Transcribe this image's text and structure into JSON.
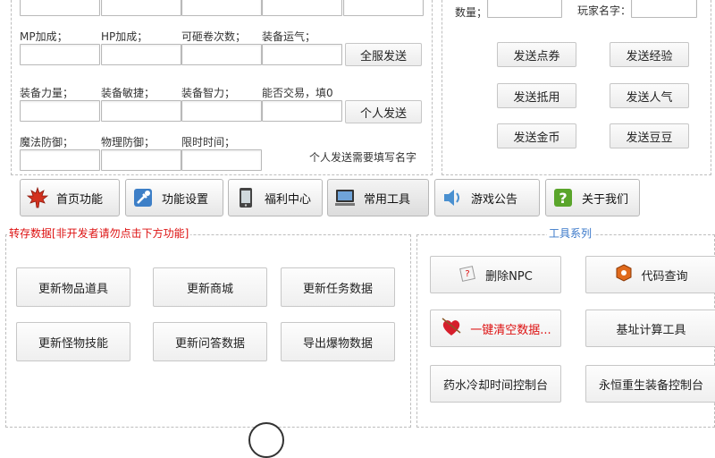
{
  "top_form": {
    "labels": {
      "mp": "MP加成；",
      "hp": "HP加成；",
      "scroll": "可砸卷次数；",
      "luck": "装备运气；",
      "str": "装备力量；",
      "dex": "装备敏捷；",
      "int": "装备智力；",
      "trade": "能否交易，填0",
      "mdef": "魔法防御；",
      "pdef": "物理防御；",
      "limit": "限时时间；"
    },
    "buttons": {
      "all_server": "全服发送",
      "personal": "个人发送"
    },
    "note": "个人发送需要填写名字"
  },
  "right_form": {
    "quantity_label": "数量；",
    "player_name_label": "玩家名字：",
    "buttons": {
      "points": "发送点券",
      "exp": "发送经验",
      "voucher": "发送抵用",
      "fame": "发送人气",
      "gold": "发送金币",
      "beans": "发送豆豆"
    }
  },
  "tabs": [
    {
      "label": "首页功能",
      "icon": "maple-leaf-icon"
    },
    {
      "label": "功能设置",
      "icon": "tools-icon"
    },
    {
      "label": "福利中心",
      "icon": "tablet-icon"
    },
    {
      "label": "常用工具",
      "icon": "computer-icon"
    },
    {
      "label": "游戏公告",
      "icon": "speaker-icon"
    },
    {
      "label": "关于我们",
      "icon": "help-icon"
    }
  ],
  "left_panel": {
    "title": "转存数据[非开发者请勿点击下方功能]",
    "buttons": [
      "更新物品道具",
      "更新商城",
      "更新任务数据",
      "更新怪物技能",
      "更新问答数据",
      "导出爆物数据"
    ]
  },
  "right_panel": {
    "title": "工具系列",
    "buttons": {
      "delete_npc": "删除NPC",
      "code_query": "代码查询",
      "clear_data": "一键清空数据...",
      "address_calc": "基址计算工具",
      "potion_cooldown": "药水冷却时间控制台",
      "rebirth_equip": "永恒重生装备控制台"
    }
  },
  "colors": {
    "accent_blue": "#3a78c9",
    "warning_red": "#dd1111"
  }
}
